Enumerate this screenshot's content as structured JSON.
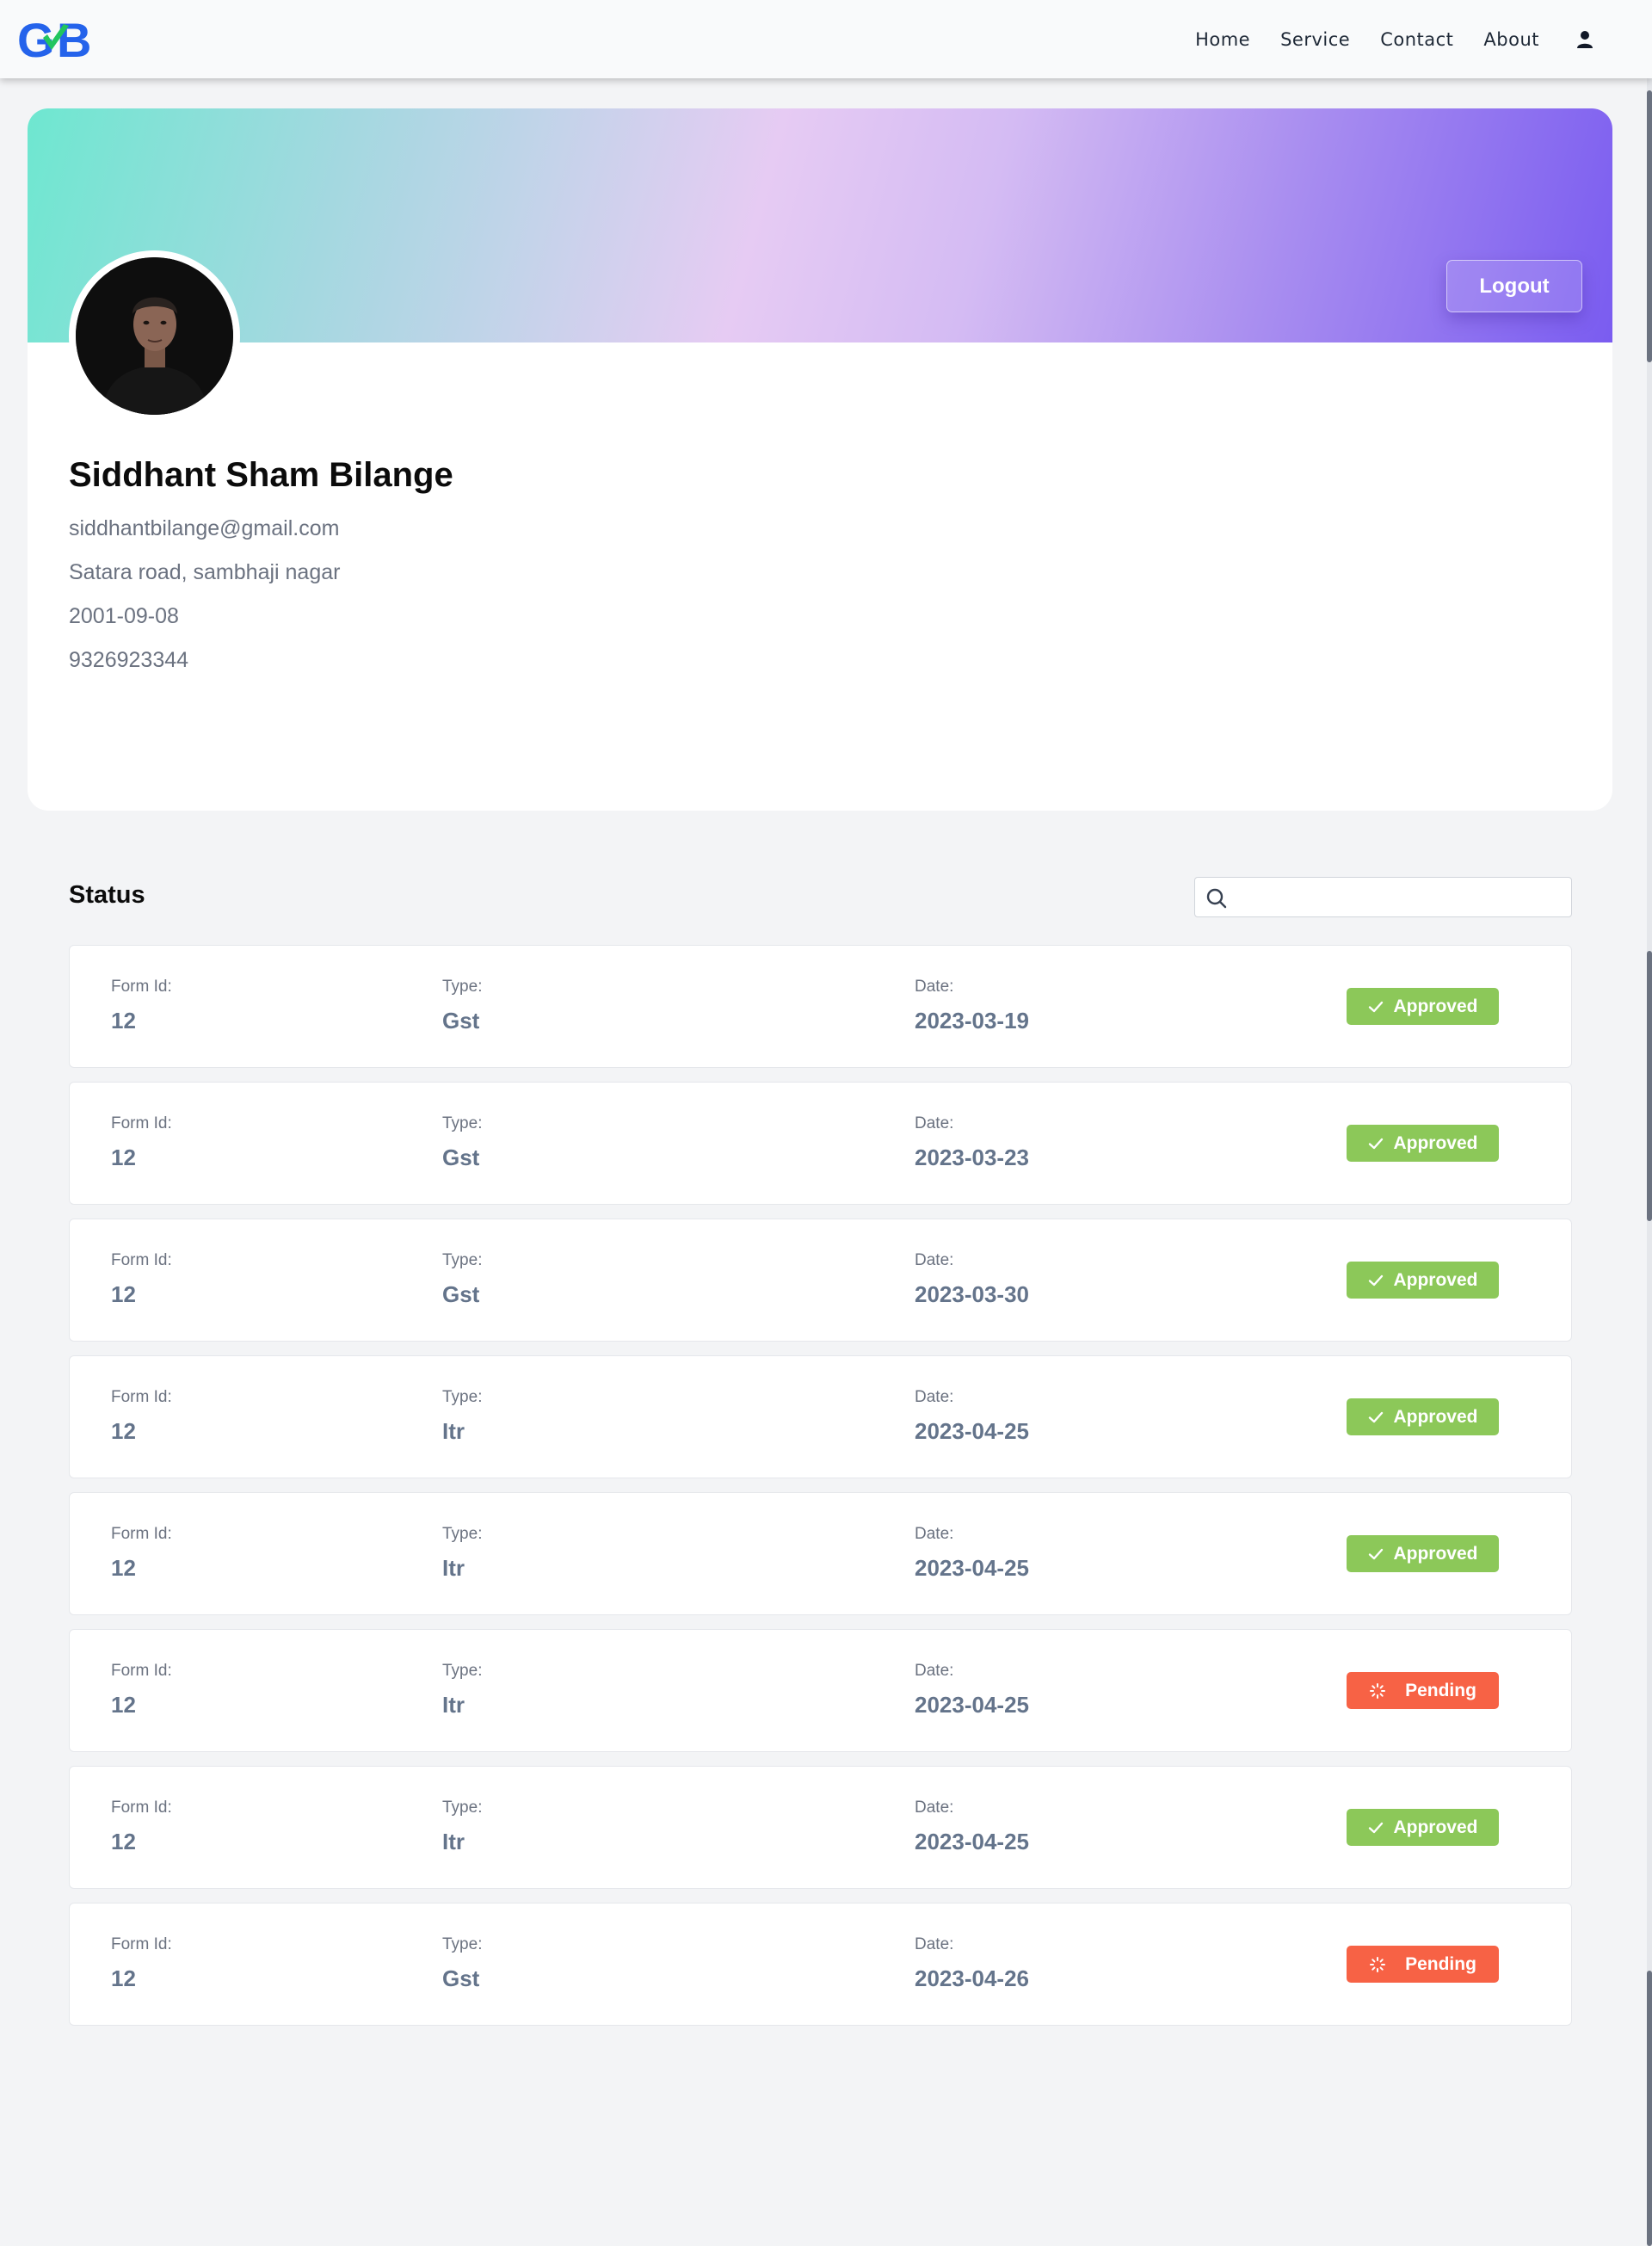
{
  "nav": {
    "logo_text": "GB",
    "links": [
      "Home",
      "Service",
      "Contact",
      "About"
    ],
    "user_icon": "user-icon"
  },
  "profile": {
    "logout_label": "Logout",
    "name": "Siddhant Sham Bilange",
    "email": "siddhantbilange@gmail.com",
    "address": "Satara road, sambhaji nagar",
    "dob": "2001-09-08",
    "phone": "9326923344",
    "avatar": "profile-photo"
  },
  "status": {
    "title": "Status",
    "search": {
      "placeholder": "",
      "value": ""
    },
    "labels": {
      "form_id": "Form Id:",
      "type": "Type:",
      "date": "Date:"
    },
    "rows": [
      {
        "form_id": "12",
        "type": "Gst",
        "date": "2023-03-19",
        "status": "Approved",
        "icon": "check-icon"
      },
      {
        "form_id": "12",
        "type": "Gst",
        "date": "2023-03-23",
        "status": "Approved",
        "icon": "check-icon"
      },
      {
        "form_id": "12",
        "type": "Gst",
        "date": "2023-03-30",
        "status": "Approved",
        "icon": "check-icon"
      },
      {
        "form_id": "12",
        "type": "Itr",
        "date": "2023-04-25",
        "status": "Approved",
        "icon": "check-icon"
      },
      {
        "form_id": "12",
        "type": "Itr",
        "date": "2023-04-25",
        "status": "Approved",
        "icon": "check-icon"
      },
      {
        "form_id": "12",
        "type": "Itr",
        "date": "2023-04-25",
        "status": "Pending",
        "icon": "spinner-icon"
      },
      {
        "form_id": "12",
        "type": "Itr",
        "date": "2023-04-25",
        "status": "Approved",
        "icon": "check-icon"
      },
      {
        "form_id": "12",
        "type": "Gst",
        "date": "2023-04-26",
        "status": "Pending",
        "icon": "spinner-icon"
      }
    ]
  },
  "colors": {
    "approved": "#8cc859",
    "pending": "#f76245",
    "logo_blue": "#2563eb",
    "logo_green": "#22c55e",
    "banner_start": "#6ee7d0",
    "banner_end": "#7a5cf0"
  }
}
